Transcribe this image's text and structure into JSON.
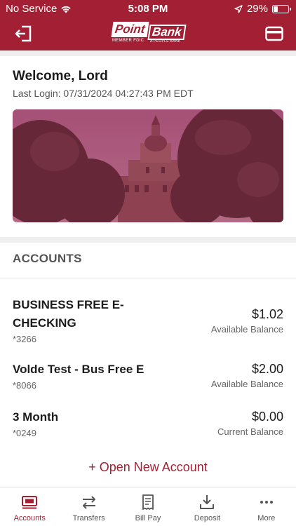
{
  "status_bar": {
    "carrier": "No Service",
    "time": "5:08 PM",
    "battery": "29%",
    "battery_level": 0.29
  },
  "header": {
    "logo_text_point": "Point",
    "logo_text_bank": "Bank",
    "logo_fdic": "MEMBER FDIC",
    "logo_tagline": "A PEOPLE BANK"
  },
  "welcome": {
    "title": "Welcome, Lord",
    "last_login": "Last Login: 07/31/2024 04:27:43 PM EDT"
  },
  "accounts": {
    "heading": "ACCOUNTS",
    "items": [
      {
        "name_line1": "BUSINESS FREE E-",
        "name_line2": "CHECKING",
        "number": "*3266",
        "amount": "$1.02",
        "balance_label": "Available Balance"
      },
      {
        "name_line1": "Volde Test - Bus Free E",
        "number": "*8066",
        "amount": "$2.00",
        "balance_label": "Available Balance"
      },
      {
        "name_line1": "3 Month",
        "number": "*0249",
        "amount": "$0.00",
        "balance_label": "Current Balance"
      }
    ],
    "open_new": "+ Open New Account"
  },
  "tabs": [
    {
      "label": "Accounts",
      "icon": "accounts-icon",
      "active": true
    },
    {
      "label": "Transfers",
      "icon": "transfer-icon",
      "active": false
    },
    {
      "label": "Bill Pay",
      "icon": "bill-icon",
      "active": false
    },
    {
      "label": "Deposit",
      "icon": "deposit-icon",
      "active": false
    },
    {
      "label": "More",
      "icon": "more-icon",
      "active": false
    }
  ],
  "colors": {
    "brand": "#a31f34",
    "background": "#efefef"
  }
}
